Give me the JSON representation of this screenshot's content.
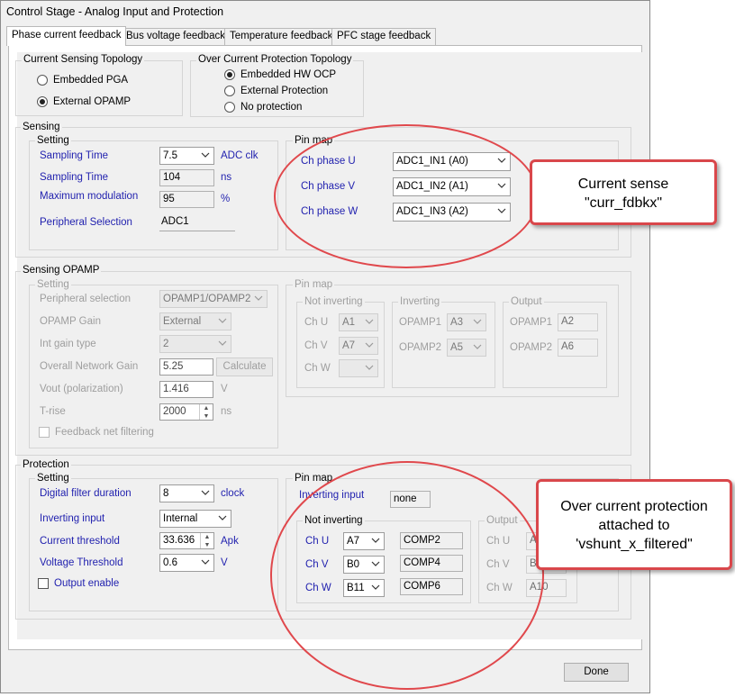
{
  "window": {
    "title": "Control Stage - Analog Input and Protection"
  },
  "tabs": [
    "Phase current feedback",
    "Bus voltage feedback",
    "Temperature feedback",
    "PFC stage feedback"
  ],
  "topology": {
    "title": "Current Sensing Topology",
    "options": [
      "Embedded PGA",
      "External OPAMP"
    ]
  },
  "ocp": {
    "title": "Over Current Protection Topology",
    "options": [
      "Embedded HW OCP",
      "External Protection",
      "No protection"
    ]
  },
  "sensing": {
    "title": "Sensing",
    "setting_title": "Setting",
    "rows": [
      {
        "label": "Sampling Time",
        "value": "7.5",
        "unit": "ADC clk"
      },
      {
        "label": "Sampling Time",
        "value": "104",
        "unit": "ns"
      },
      {
        "label": "Maximum modulation",
        "value": "95",
        "unit": "%"
      },
      {
        "label": "Peripheral Selection",
        "value": "ADC1"
      }
    ],
    "pinmap_title": "Pin map",
    "pins": [
      {
        "label": "Ch phase U",
        "value": "ADC1_IN1 (A0)"
      },
      {
        "label": "Ch phase V",
        "value": "ADC1_IN2 (A1)"
      },
      {
        "label": "Ch phase W",
        "value": "ADC1_IN3 (A2)"
      }
    ]
  },
  "opamp": {
    "title": "Sensing OPAMP",
    "setting_title": "Setting",
    "rows": [
      {
        "label": "Peripheral selection",
        "value": "OPAMP1/OPAMP2"
      },
      {
        "label": "OPAMP Gain",
        "value": "External"
      },
      {
        "label": "Int gain type",
        "value": "2"
      },
      {
        "label": "Overall Network Gain",
        "value": "5.25",
        "button": "Calculate"
      },
      {
        "label": "Vout (polarization)",
        "value": "1.416",
        "unit": "V"
      },
      {
        "label": "T-rise",
        "value": "2000",
        "unit": "ns"
      }
    ],
    "feedback_label": "Feedback net filtering",
    "pinmap_title": "Pin map",
    "not_inverting": {
      "title": "Not inverting",
      "rows": [
        {
          "label": "Ch U",
          "value": "A1"
        },
        {
          "label": "Ch V",
          "value": "A7"
        },
        {
          "label": "Ch W",
          "value": ""
        }
      ]
    },
    "inverting": {
      "title": "Inverting",
      "rows": [
        {
          "label": "OPAMP1",
          "value": "A3"
        },
        {
          "label": "OPAMP2",
          "value": "A5"
        }
      ]
    },
    "output": {
      "title": "Output",
      "rows": [
        {
          "label": "OPAMP1",
          "value": "A2"
        },
        {
          "label": "OPAMP2",
          "value": "A6"
        }
      ]
    }
  },
  "protection": {
    "title": "Protection",
    "setting_title": "Setting",
    "rows": [
      {
        "label": "Digital filter duration",
        "value": "8",
        "unit": "clock"
      },
      {
        "label": "Inverting input",
        "value": "Internal"
      },
      {
        "label": "Current threshold",
        "value": "33.636",
        "unit": "Apk"
      },
      {
        "label": "Voltage Threshold",
        "value": "0.6",
        "unit": "V"
      }
    ],
    "output_enable": "Output enable",
    "pinmap_title": "Pin map",
    "inverting_input_label": "Inverting input",
    "inverting_input_value": "none",
    "not_inverting": {
      "title": "Not inverting",
      "rows": [
        {
          "label": "Ch U",
          "value": "A7",
          "comp": "COMP2"
        },
        {
          "label": "Ch V",
          "value": "B0",
          "comp": "COMP4"
        },
        {
          "label": "Ch W",
          "value": "B11",
          "comp": "COMP6"
        }
      ]
    },
    "output": {
      "title": "Output",
      "rows": [
        {
          "label": "Ch U",
          "value": "A"
        },
        {
          "label": "Ch V",
          "value": "B"
        },
        {
          "label": "Ch W",
          "value": "A10"
        }
      ]
    }
  },
  "done_label": "Done",
  "annotations": {
    "callout1": [
      "Current sense",
      "\"curr_fdbkx\""
    ],
    "callout2": [
      "Over current protection",
      "attached to",
      "'vshunt_x_filtered\""
    ]
  },
  "colors": {
    "label_blue": "#1f1fae",
    "annotation_red": "#d9474b"
  }
}
